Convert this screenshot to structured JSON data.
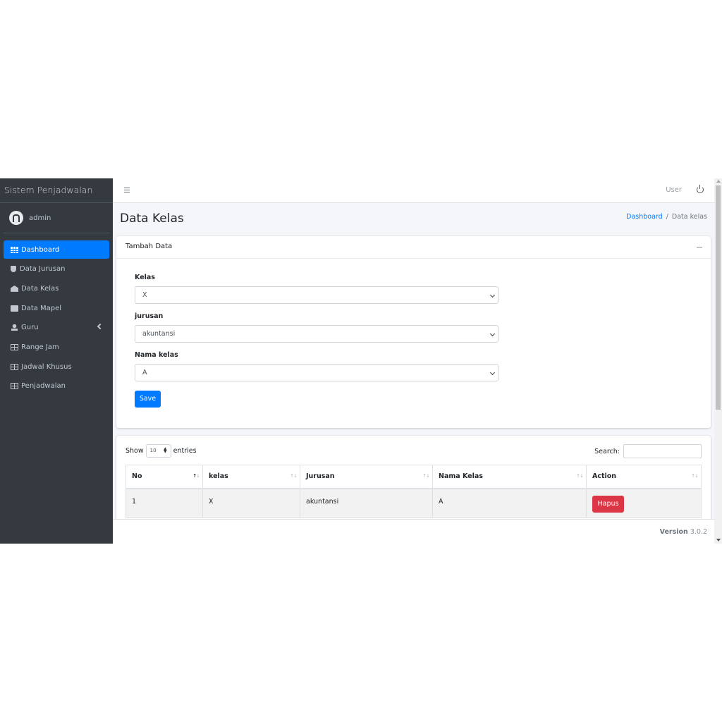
{
  "brand": "Sistem Penjadwalan",
  "user": {
    "name": "admin"
  },
  "sidebar": {
    "items": [
      {
        "label": "Dashboard",
        "icon": "th-icon"
      },
      {
        "label": "Data Jurusan",
        "icon": "shield-icon"
      },
      {
        "label": "Data Kelas",
        "icon": "school-icon"
      },
      {
        "label": "Data Mapel",
        "icon": "book-open-icon"
      },
      {
        "label": "Guru",
        "icon": "user-icon"
      },
      {
        "label": "Range Jam",
        "icon": "table-icon"
      },
      {
        "label": "Jadwal Khusus",
        "icon": "table-icon"
      },
      {
        "label": "Penjadwalan",
        "icon": "table-icon"
      }
    ]
  },
  "topbar": {
    "user_label": "User"
  },
  "page": {
    "title": "Data Kelas"
  },
  "breadcrumb": {
    "home": "Dashboard",
    "sep": "/",
    "current": "Data kelas"
  },
  "form": {
    "card_title": "Tambah Data",
    "kelas_label": "Kelas",
    "kelas_value": "X",
    "jurusan_label": "jurusan",
    "jurusan_value": "akuntansi",
    "nama_kelas_label": "Nama kelas",
    "nama_kelas_value": "A",
    "save_label": "Save"
  },
  "table": {
    "show_label": "Show",
    "length_value": "10",
    "entries_label": "entries",
    "search_label": "Search:",
    "columns": [
      "No",
      "kelas",
      "Jurusan",
      "Nama Kelas",
      "Action"
    ],
    "rows": [
      {
        "no": "1",
        "kelas": "X",
        "jurusan": "akuntansi",
        "nama_kelas": "A",
        "action": "Hapus"
      }
    ]
  },
  "footer": {
    "version_label": "Version",
    "version_number": "3.0.2"
  },
  "colors": {
    "primary": "#007bff",
    "danger": "#dc3545",
    "sidebar_bg": "#343a40",
    "content_bg": "#f4f6f9"
  }
}
